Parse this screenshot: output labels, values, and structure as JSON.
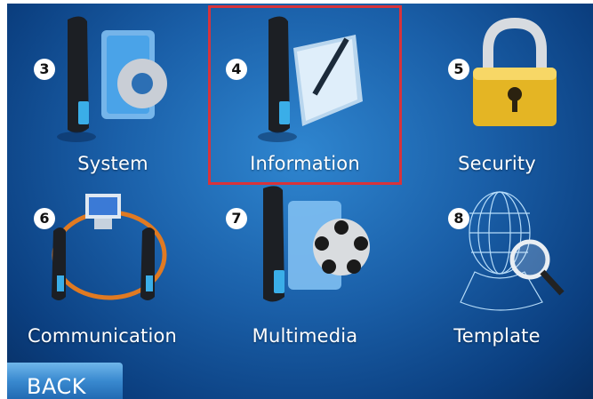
{
  "menu": {
    "items": [
      {
        "number": "3",
        "label": "System"
      },
      {
        "number": "4",
        "label": "Information"
      },
      {
        "number": "5",
        "label": "Security"
      },
      {
        "number": "6",
        "label": "Communication"
      },
      {
        "number": "7",
        "label": "Multimedia"
      },
      {
        "number": "8",
        "label": "Template"
      }
    ],
    "selected_label": "Information"
  },
  "back": {
    "label": "BACK"
  },
  "icons": {
    "system": "scanner-gear-icon",
    "information": "scanner-notepad-icon",
    "security": "padlock-icon",
    "communication": "network-devices-icon",
    "multimedia": "film-reel-icon",
    "template": "face-scan-icon"
  },
  "colors": {
    "background": "#1a5fa8",
    "selection_border": "#d8333b",
    "back_button": "#3a8ad0"
  }
}
